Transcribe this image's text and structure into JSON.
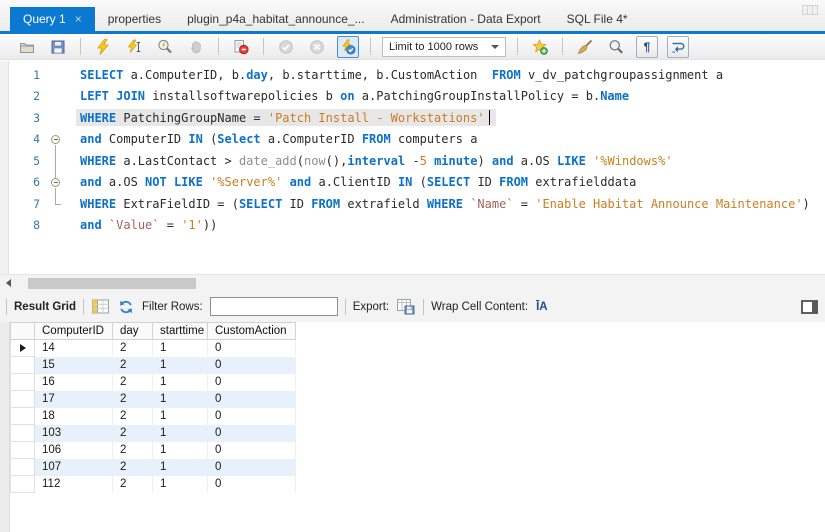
{
  "tab_bar": {
    "tabs": [
      {
        "label": "Query 1",
        "active": true,
        "closable": true
      },
      {
        "label": "properties",
        "active": false,
        "closable": false
      },
      {
        "label": "plugin_p4a_habitat_announce_...",
        "active": false,
        "closable": false
      },
      {
        "label": "Administration - Data Export",
        "active": false,
        "closable": false
      },
      {
        "label": "SQL File 4*",
        "active": false,
        "closable": false
      }
    ]
  },
  "toolbar": {
    "limit_label": "Limit to 1000 rows",
    "items": [
      {
        "icon": "open-script"
      },
      {
        "icon": "save-script"
      },
      {
        "sep": true
      },
      {
        "icon": "execute-script"
      },
      {
        "icon": "execute-current-statement"
      },
      {
        "icon": "explain-plan"
      },
      {
        "icon": "stop-query",
        "disabled": true
      },
      {
        "sep": true
      },
      {
        "icon": "toggle-stop-on-error"
      },
      {
        "sep": true
      },
      {
        "icon": "commit",
        "disabled": true
      },
      {
        "icon": "rollback",
        "disabled": true
      },
      {
        "icon": "toggle-autocommit",
        "selected": true
      },
      {
        "sep": true
      },
      {
        "dropdown": true
      },
      {
        "sep": true
      },
      {
        "icon": "save-snippet"
      },
      {
        "sep": true
      },
      {
        "icon": "beautify-query"
      },
      {
        "icon": "find-in-editor"
      },
      {
        "icon": "show-invisibles",
        "boxed": true
      },
      {
        "icon": "toggle-word-wrap",
        "boxed": true
      }
    ]
  },
  "editor": {
    "lines": [
      {
        "n": 1,
        "fold": "",
        "hl": false,
        "cursor": false,
        "tokens": [
          [
            "kw",
            "SELECT"
          ],
          [
            "pl",
            " a.ComputerID, b."
          ],
          [
            "kw",
            "day"
          ],
          [
            "pl",
            ", b.starttime, b.CustomAction  "
          ],
          [
            "kw",
            "FROM"
          ],
          [
            "pl",
            " v_dv_patchgroupassignment a"
          ]
        ]
      },
      {
        "n": 2,
        "fold": "",
        "hl": false,
        "cursor": false,
        "tokens": [
          [
            "kw",
            "LEFT JOIN"
          ],
          [
            "pl",
            " installsoftwarepolicies b "
          ],
          [
            "kw",
            "on"
          ],
          [
            "pl",
            " a.PatchingGroupInstallPolicy = b."
          ],
          [
            "kw",
            "Name"
          ]
        ]
      },
      {
        "n": 3,
        "fold": "",
        "hl": true,
        "cursor": true,
        "tokens": [
          [
            "kw",
            "WHERE"
          ],
          [
            "pl",
            " PatchingGroupName = "
          ],
          [
            "str",
            "'Patch Install - Workstations'"
          ]
        ]
      },
      {
        "n": 4,
        "fold": "start",
        "hl": false,
        "cursor": false,
        "tokens": [
          [
            "kw",
            "and"
          ],
          [
            "pl",
            " ComputerID "
          ],
          [
            "kw",
            "IN"
          ],
          [
            "pl",
            " ("
          ],
          [
            "kw",
            "Select"
          ],
          [
            "pl",
            " a.ComputerID "
          ],
          [
            "kw",
            "FROM"
          ],
          [
            "pl",
            " computers a"
          ]
        ]
      },
      {
        "n": 5,
        "fold": "mid",
        "hl": false,
        "cursor": false,
        "tokens": [
          [
            "kw",
            "WHERE"
          ],
          [
            "pl",
            " a.LastContact > "
          ],
          [
            "fn",
            "date_add"
          ],
          [
            "pl",
            "("
          ],
          [
            "fn",
            "now"
          ],
          [
            "pl",
            "(),"
          ],
          [
            "kw",
            "interval"
          ],
          [
            "pl",
            " -"
          ],
          [
            "num",
            "5"
          ],
          [
            "pl",
            " "
          ],
          [
            "kw",
            "minute"
          ],
          [
            "pl",
            ") "
          ],
          [
            "kw",
            "and"
          ],
          [
            "pl",
            " a.OS "
          ],
          [
            "kw",
            "LIKE"
          ],
          [
            "pl",
            " "
          ],
          [
            "str",
            "'%Windows%'"
          ]
        ]
      },
      {
        "n": 6,
        "fold": "branch",
        "hl": false,
        "cursor": false,
        "tokens": [
          [
            "kw",
            "and"
          ],
          [
            "pl",
            " a.OS "
          ],
          [
            "kw",
            "NOT LIKE"
          ],
          [
            "pl",
            " "
          ],
          [
            "str",
            "'%Server%'"
          ],
          [
            "pl",
            " "
          ],
          [
            "kw",
            "and"
          ],
          [
            "pl",
            " a.ClientID "
          ],
          [
            "kw",
            "IN"
          ],
          [
            "pl",
            " ("
          ],
          [
            "kw",
            "SELECT"
          ],
          [
            "pl",
            " ID "
          ],
          [
            "kw",
            "FROM"
          ],
          [
            "pl",
            " extrafielddata"
          ]
        ]
      },
      {
        "n": 7,
        "fold": "end",
        "hl": false,
        "cursor": false,
        "tokens": [
          [
            "kw",
            "WHERE"
          ],
          [
            "pl",
            " ExtraFieldID = ("
          ],
          [
            "kw",
            "SELECT"
          ],
          [
            "pl",
            " ID "
          ],
          [
            "kw",
            "FROM"
          ],
          [
            "pl",
            " extrafield "
          ],
          [
            "kw",
            "WHERE"
          ],
          [
            "pl",
            " "
          ],
          [
            "bt",
            "`Name`"
          ],
          [
            "pl",
            " = "
          ],
          [
            "str",
            "'Enable Habitat Announce Maintenance'"
          ],
          [
            "pl",
            ")"
          ]
        ]
      },
      {
        "n": 8,
        "fold": "",
        "hl": false,
        "cursor": false,
        "tokens": [
          [
            "kw",
            "and"
          ],
          [
            "pl",
            " "
          ],
          [
            "bt",
            "`Value`"
          ],
          [
            "pl",
            " = "
          ],
          [
            "str",
            "'1'"
          ],
          [
            "pl",
            "))"
          ]
        ]
      }
    ]
  },
  "result_toolbar": {
    "title": "Result Grid",
    "filter_label": "Filter Rows:",
    "filter_value": "",
    "export_label": "Export:",
    "wrap_label": "Wrap Cell Content:",
    "wrap_icon_text": "ĪA"
  },
  "table": {
    "columns": [
      "ComputerID",
      "day",
      "starttime",
      "CustomAction"
    ],
    "rows": [
      [
        "14",
        "2",
        "1",
        "0"
      ],
      [
        "15",
        "2",
        "1",
        "0"
      ],
      [
        "16",
        "2",
        "1",
        "0"
      ],
      [
        "17",
        "2",
        "1",
        "0"
      ],
      [
        "18",
        "2",
        "1",
        "0"
      ],
      [
        "103",
        "2",
        "1",
        "0"
      ],
      [
        "106",
        "2",
        "1",
        "0"
      ],
      [
        "107",
        "2",
        "1",
        "0"
      ],
      [
        "112",
        "2",
        "1",
        "0"
      ]
    ]
  },
  "colors": {
    "active_tab": "#0b79d0",
    "keyword": "#0d72c7",
    "string": "#ca7e1f",
    "function": "#8e8e8e",
    "quoted_identifier": "#a4635c",
    "line_number": "#3178b0",
    "row_alt": "#e7f1fb",
    "line_highlight": "#e7e7e7"
  }
}
